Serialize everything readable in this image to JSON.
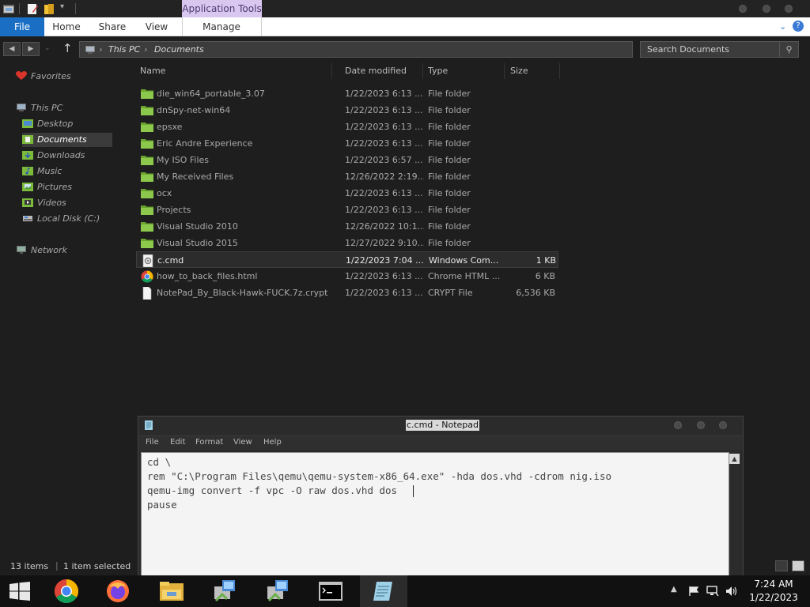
{
  "titlebar": {
    "contextual_tab": "Application Tools"
  },
  "ribbon": {
    "tabs": [
      "File",
      "Home",
      "Share",
      "View",
      "Manage"
    ]
  },
  "address": {
    "crumbs": [
      "This PC",
      "Documents"
    ],
    "search_placeholder": "Search Documents"
  },
  "nav": {
    "favorites": "Favorites",
    "this_pc": "This PC",
    "items": [
      "Desktop",
      "Documents",
      "Downloads",
      "Music",
      "Pictures",
      "Videos",
      "Local Disk (C:)"
    ],
    "network": "Network"
  },
  "columns": [
    "Name",
    "Date modified",
    "Type",
    "Size"
  ],
  "files": [
    {
      "name": "die_win64_portable_3.07",
      "date": "1/22/2023 6:13 ...",
      "type": "File folder",
      "size": "",
      "kind": "folder"
    },
    {
      "name": "dnSpy-net-win64",
      "date": "1/22/2023 6:13 ...",
      "type": "File folder",
      "size": "",
      "kind": "folder"
    },
    {
      "name": "epsxe",
      "date": "1/22/2023 6:13 ...",
      "type": "File folder",
      "size": "",
      "kind": "folder"
    },
    {
      "name": "Eric Andre Experience",
      "date": "1/22/2023 6:13 ...",
      "type": "File folder",
      "size": "",
      "kind": "folder"
    },
    {
      "name": "My ISO Files",
      "date": "1/22/2023 6:57 ...",
      "type": "File folder",
      "size": "",
      "kind": "folder"
    },
    {
      "name": "My Received Files",
      "date": "12/26/2022 2:19...",
      "type": "File folder",
      "size": "",
      "kind": "folder"
    },
    {
      "name": "ocx",
      "date": "1/22/2023 6:13 ...",
      "type": "File folder",
      "size": "",
      "kind": "folder"
    },
    {
      "name": "Projects",
      "date": "1/22/2023 6:13 ...",
      "type": "File folder",
      "size": "",
      "kind": "folder"
    },
    {
      "name": "Visual Studio 2010",
      "date": "12/26/2022 10:1...",
      "type": "File folder",
      "size": "",
      "kind": "folder"
    },
    {
      "name": "Visual Studio 2015",
      "date": "12/27/2022 9:10...",
      "type": "File folder",
      "size": "",
      "kind": "folder"
    },
    {
      "name": "c.cmd",
      "date": "1/22/2023 7:04 ...",
      "type": "Windows Com...",
      "size": "1 KB",
      "kind": "cmd"
    },
    {
      "name": "how_to_back_files.html",
      "date": "1/22/2023 6:13 ...",
      "type": "Chrome HTML ...",
      "size": "6 KB",
      "kind": "chrome"
    },
    {
      "name": "NotePad_By_Black-Hawk-FUCK.7z.crypt",
      "date": "1/22/2023 6:13 ...",
      "type": "CRYPT File",
      "size": "6,536 KB",
      "kind": "blank"
    }
  ],
  "status": {
    "count": "13 items",
    "selected": "1 item selected"
  },
  "notepad": {
    "title": "c.cmd - Notepad",
    "menu": [
      "File",
      "Edit",
      "Format",
      "View",
      "Help"
    ],
    "lines": [
      "cd \\",
      "rem \"C:\\Program Files\\qemu\\qemu-system-x86_64.exe\" -hda dos.vhd -cdrom nig.iso",
      "qemu-img convert -f vpc -O raw dos.vhd dos",
      "pause"
    ]
  },
  "taskbar": {
    "time": "7:24 AM",
    "date": "1/22/2023"
  },
  "colors": {
    "accent": "#1a6fc4",
    "folder": "#7cba3c",
    "app_tools": "#d9c7f0"
  }
}
